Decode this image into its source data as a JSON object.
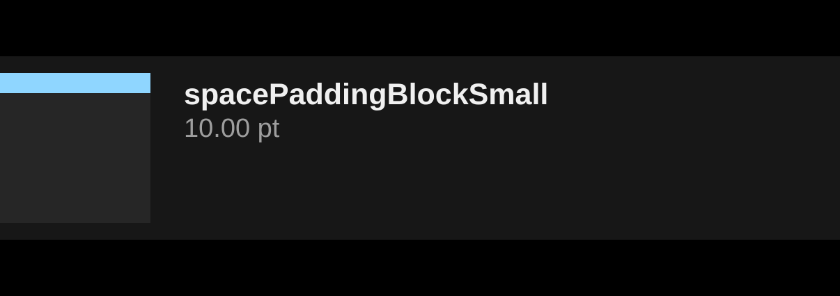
{
  "token": {
    "name": "spacePaddingBlockSmall",
    "value": "10.00 pt"
  },
  "colors": {
    "page_background": "#000000",
    "row_background": "#171717",
    "swatch_background": "#262626",
    "padding_indicator": "#8fd6ff",
    "name_text": "#f0f0f0",
    "value_text": "#9e9e9e"
  }
}
